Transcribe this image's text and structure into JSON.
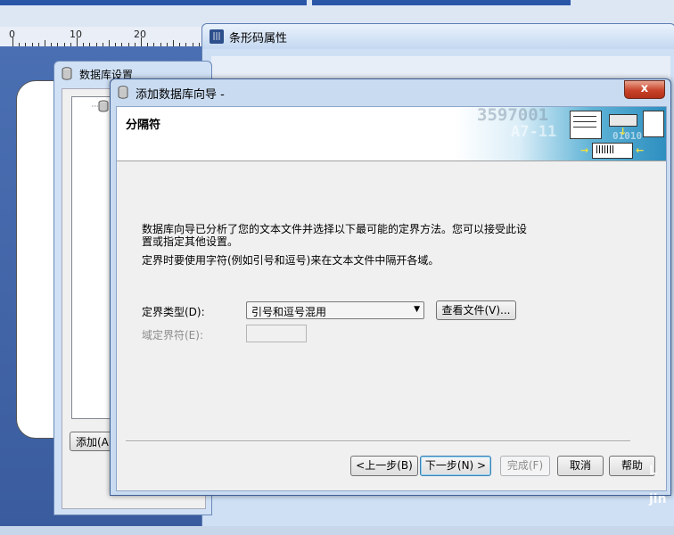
{
  "background_app": {
    "ruler_labels": [
      "0",
      "10",
      "20"
    ],
    "barcode_window_title": "条形码属性",
    "database_window_title": "数据库设置",
    "database_add_button": "添加(A"
  },
  "wizard": {
    "title": "添加数据库向导 -",
    "close_glyph": "x",
    "header": {
      "title": "分隔符",
      "decor_number_1": "3597001",
      "decor_number_2": "A7-11",
      "decor_number_3": "01010"
    },
    "body": {
      "paragraph_1": "数据库向导已分析了您的文本文件并选择以下最可能的定界方法。您可以接受此设置或指定其他设置。",
      "paragraph_2": "定界时要使用字符(例如引号和逗号)来在文本文件中隔开各域。"
    },
    "form": {
      "delimiter_type_label": "定界类型(D):",
      "delimiter_type_value": "引号和逗号混用",
      "view_file_button": "查看文件(V)...",
      "field_delimiter_label": "域定界符(E):",
      "field_delimiter_value": ""
    },
    "buttons": {
      "back": "<上一步(B)",
      "next": "下一步(N) >",
      "finish": "完成(F)",
      "cancel": "取消",
      "help": "帮助"
    }
  },
  "watermark": "L\njin",
  "colors": {
    "title_bar": "#c9dbf1",
    "close_button": "#c8432a",
    "header_accent": "#2e8fc0"
  }
}
